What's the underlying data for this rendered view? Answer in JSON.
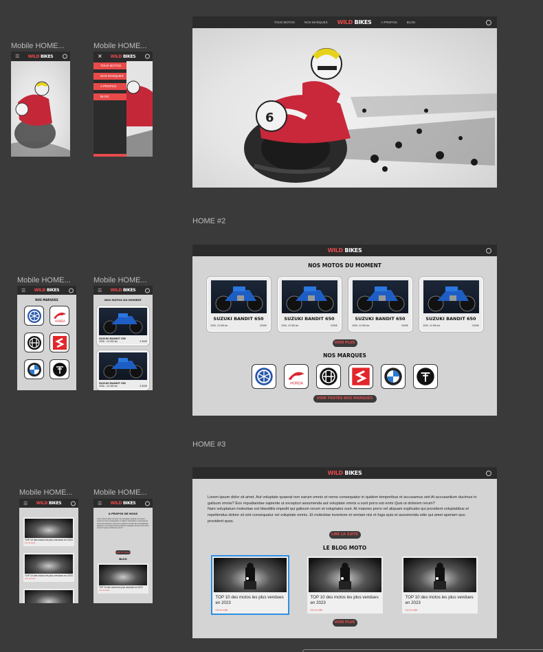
{
  "brand": {
    "wild": "WILD",
    "bikes": "BIKES"
  },
  "mobile_frames": {
    "label": "Mobile HOME..."
  },
  "sections": {
    "home2": "HOME #2",
    "home3": "HOME #3"
  },
  "desktop_nav": [
    "TOUS MOTOS",
    "NOS MARQUES",
    "A PROPOS",
    "BLOG"
  ],
  "mobile_menu": [
    "TOUS MOTOS",
    "NOS MARQUES",
    "A PROPOS",
    "BLOG"
  ],
  "motos": {
    "title": "NOS MOTOS DU MOMENT",
    "cards": [
      {
        "name": "SUZUKI BANDIT 650",
        "meta": "2006 - 24 000 km",
        "price": "3 500€"
      },
      {
        "name": "SUZUKI BANDIT 650",
        "meta": "2006 - 24 000 km",
        "price": "3 500€"
      },
      {
        "name": "SUZUKI BANDIT 650",
        "meta": "2006 - 24 000 km",
        "price": "3 500€"
      },
      {
        "name": "SUZUKI BANDIT 650",
        "meta": "2006 - 24 000 km",
        "price": "3 500€"
      }
    ],
    "more_button": "VOIR PLUS"
  },
  "marques": {
    "title": "NOS MARQUES",
    "brands": [
      "yamaha",
      "honda",
      "royal-enfield",
      "suzuki",
      "bmw",
      "triumph"
    ],
    "button": "VOIR TOUTES NOS MARQUES"
  },
  "about": {
    "title": "A PROPOS DE NOUS",
    "p1": "Lorem ipsum dolor sit amet. Aut voluptate quaerat non earum omnis et nemo consequatur in quidem temporibus et accusamus sint At accusantium ducimus in galisum omnis? Eos repudiandae sapiente ut excepturi assumenda aut voluptate omnis a sunt porro est enim Quis ut dolorem rerum?",
    "p2": "Nam voluptatum molestiae est blanditiis impedit qui galisum rerum et voluptates sunt. At maiores porro vel aliquam explicabo qui provident voluptatibus et repellendus dolore sit sint consequatur vel voluptate omnis. Et molestiae inventore et veniam nisi et fuga quia et assumenda odio qui amet aperiam quo provident quos.",
    "button": "LIRE LA SUITE"
  },
  "blog": {
    "title": "LE BLOG MOTO",
    "posts": [
      {
        "title": "TOP 10 des motos les plus vendues en 2023",
        "link": "Lire la suite"
      },
      {
        "title": "TOP 10 des motos les plus vendues en 2023",
        "link": "Lire la suite"
      },
      {
        "title": "TOP 10 des motos les plus vendues en 2023",
        "link": "Lire la suite"
      }
    ],
    "more_button": "VOIR PLUS"
  },
  "mobile_brands_title": "NOS MARQUES",
  "mobile_motos_title": "NOS MOTOS DU MOMENT",
  "mobile_card": {
    "name": "SUZUKI BANDIT 650",
    "meta": "2006 - 24 000 km",
    "price": "3 500€"
  },
  "mobile_blog_post": "TOP 10 des motos les plus vendues en 2023",
  "mobile_blog_link": "Lire la suite",
  "mobile_about_title": "A PROPOS DE NOUS",
  "mobile_about_button": "LIRE LA SUITE",
  "mobile_blog_title": "BLOG",
  "colors": {
    "accent": "#e84a4a",
    "bg": "#3a3a3a",
    "panel": "#d4d4d4"
  }
}
